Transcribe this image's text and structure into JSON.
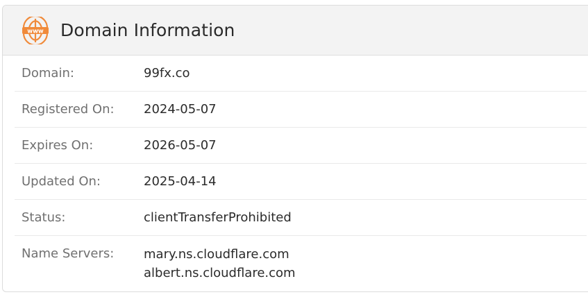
{
  "panel": {
    "title": "Domain Information",
    "icon": "www-globe-icon",
    "accent_color": "#f08a3a"
  },
  "rows": [
    {
      "label": "Domain:",
      "value": "99fx.co"
    },
    {
      "label": "Registered On:",
      "value": "2024-05-07"
    },
    {
      "label": "Expires On:",
      "value": "2026-05-07"
    },
    {
      "label": "Updated On:",
      "value": "2025-04-14"
    },
    {
      "label": "Status:",
      "value": "clientTransferProhibited"
    }
  ],
  "name_servers": {
    "label": "Name Servers:",
    "values": [
      "mary.ns.cloudflare.com",
      "albert.ns.cloudflare.com"
    ]
  }
}
